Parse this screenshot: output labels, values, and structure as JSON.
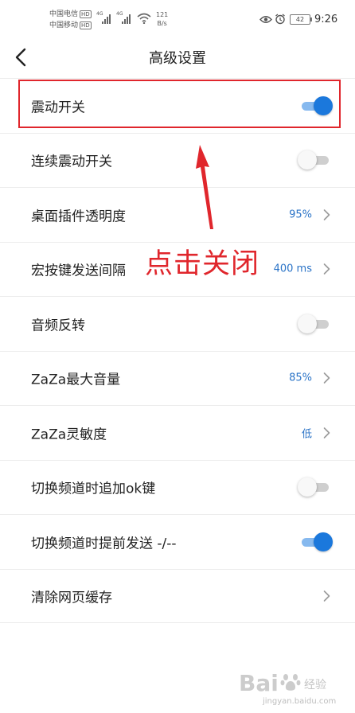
{
  "status_bar": {
    "carrier1": "中国电信",
    "carrier2": "中国移动",
    "hd": "HD",
    "net1": "4G",
    "net2": "4G",
    "speed_value": "121",
    "speed_unit": "B/s",
    "battery": "42",
    "time": "9:26"
  },
  "header": {
    "title": "高级设置",
    "back_icon": "chevron-left-icon"
  },
  "settings": [
    {
      "label": "震动开关",
      "control": "toggle",
      "on": true
    },
    {
      "label": "连续震动开关",
      "control": "toggle",
      "on": false
    },
    {
      "label": "桌面插件透明度",
      "control": "value",
      "value": "95%"
    },
    {
      "label": "宏按键发送间隔",
      "control": "value",
      "value": "400 ms"
    },
    {
      "label": "音频反转",
      "control": "toggle",
      "on": false
    },
    {
      "label": "ZaZa最大音量",
      "control": "value",
      "value": "85%"
    },
    {
      "label": "ZaZa灵敏度",
      "control": "value",
      "value": "低"
    },
    {
      "label": "切换频道时追加ok键",
      "control": "toggle",
      "on": false
    },
    {
      "label": "切换频道时提前发送 -/--",
      "control": "toggle",
      "on": true
    },
    {
      "label": "清除网页缓存",
      "control": "chevron"
    }
  ],
  "annotation": {
    "text": "点击关闭",
    "color": "#e0262c"
  },
  "watermark": {
    "brand": "Bai",
    "sub": "经验",
    "url": "jingyan.baidu.com"
  },
  "colors": {
    "accent": "#1b78dc",
    "value_text": "#2a73c7"
  }
}
